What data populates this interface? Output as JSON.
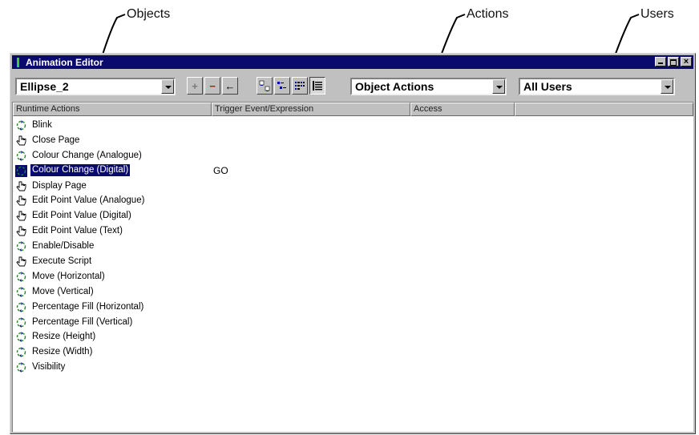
{
  "annotations": {
    "objects": "Objects",
    "actions": "Actions",
    "users": "Users"
  },
  "window": {
    "title": "Animation Editor"
  },
  "toolbar": {
    "object_select": "Ellipse_2",
    "actions_select": "Object Actions",
    "users_select": "All Users",
    "add_glyph": "+",
    "remove_glyph": "−",
    "back_glyph": "←"
  },
  "columns": [
    "Runtime Actions",
    "Trigger Event/Expression",
    "Access",
    ""
  ],
  "rows": [
    {
      "label": "Blink",
      "icon": "animation-icon",
      "trigger": ""
    },
    {
      "label": "Close Page",
      "icon": "hand-pointer-icon",
      "trigger": ""
    },
    {
      "label": "Colour Change (Analogue)",
      "icon": "animation-icon",
      "trigger": ""
    },
    {
      "label": "Colour Change (Digital)",
      "icon": "animation-icon",
      "trigger": "GO",
      "selected": true
    },
    {
      "label": "Display Page",
      "icon": "hand-pointer-icon",
      "trigger": ""
    },
    {
      "label": "Edit Point Value (Analogue)",
      "icon": "hand-pointer-icon",
      "trigger": ""
    },
    {
      "label": "Edit Point Value (Digital)",
      "icon": "hand-pointer-icon",
      "trigger": ""
    },
    {
      "label": "Edit Point Value (Text)",
      "icon": "hand-pointer-icon",
      "trigger": ""
    },
    {
      "label": "Enable/Disable",
      "icon": "animation-icon",
      "trigger": ""
    },
    {
      "label": "Execute Script",
      "icon": "hand-pointer-icon",
      "trigger": ""
    },
    {
      "label": "Move (Horizontal)",
      "icon": "animation-icon",
      "trigger": ""
    },
    {
      "label": "Move (Vertical)",
      "icon": "animation-icon",
      "trigger": ""
    },
    {
      "label": "Percentage Fill (Horizontal)",
      "icon": "animation-icon",
      "trigger": ""
    },
    {
      "label": "Percentage Fill (Vertical)",
      "icon": "animation-icon",
      "trigger": ""
    },
    {
      "label": "Resize (Height)",
      "icon": "animation-icon",
      "trigger": ""
    },
    {
      "label": "Resize (Width)",
      "icon": "animation-icon",
      "trigger": ""
    },
    {
      "label": "Visibility",
      "icon": "animation-icon",
      "trigger": ""
    }
  ],
  "colors": {
    "titlebar": "#0a0a6e",
    "window": "#c0c0c0",
    "selection": "#0a0a6e"
  }
}
